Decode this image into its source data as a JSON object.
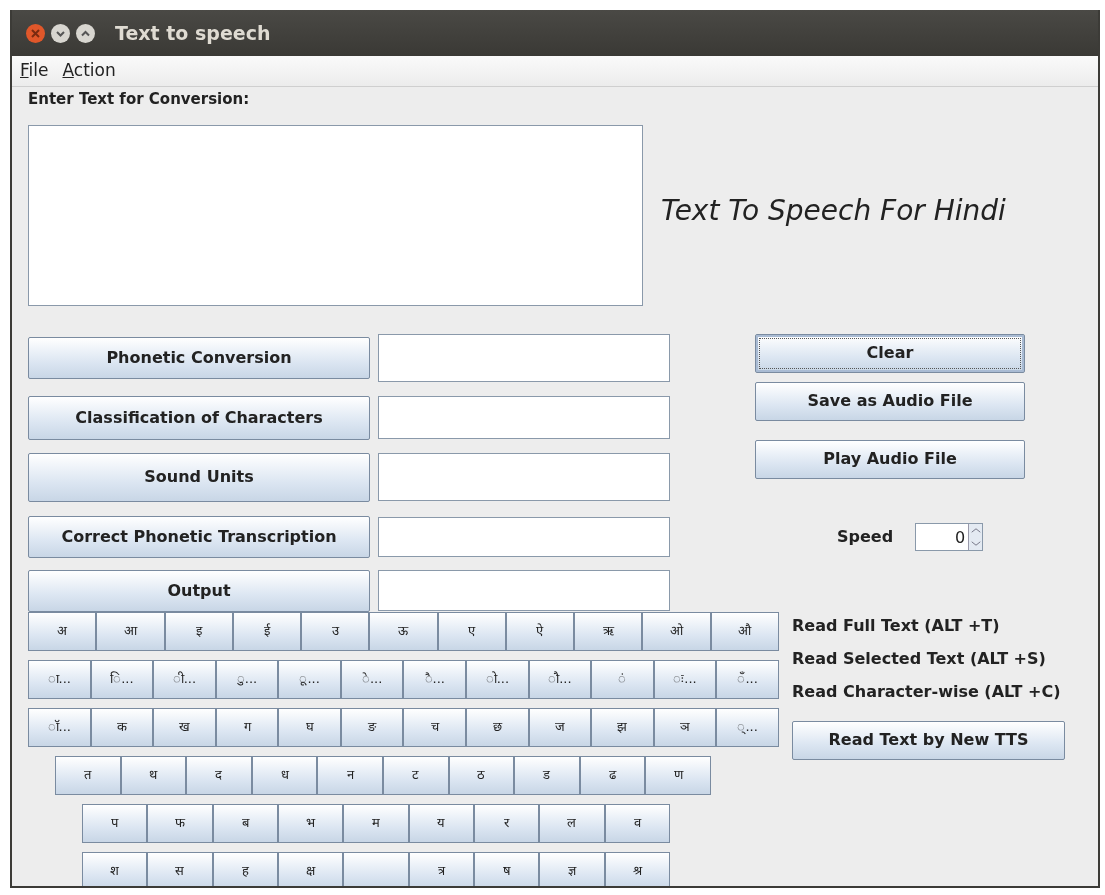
{
  "window": {
    "title": "Text to speech"
  },
  "menu": [
    {
      "label": "File"
    },
    {
      "label": "Action"
    }
  ],
  "input": {
    "label": "Enter Text for Conversion:"
  },
  "heading": "Text To Speech For Hindi",
  "conversion_rows": [
    {
      "button": "Phonetic Conversion",
      "value": ""
    },
    {
      "button": "Classification of Characters",
      "value": ""
    },
    {
      "button": "Sound Units",
      "value": ""
    },
    {
      "button": "Correct Phonetic Transcription",
      "value": ""
    },
    {
      "button": "Output",
      "value": ""
    }
  ],
  "actions": [
    {
      "label": "Clear",
      "focused": true
    },
    {
      "label": "Save as Audio File",
      "focused": false
    },
    {
      "label": "Play Audio File",
      "focused": false
    }
  ],
  "speed": {
    "label": "Speed",
    "value": "0"
  },
  "keyboard_rows": [
    [
      "अ",
      "आ",
      "इ",
      "ई",
      "उ",
      "ऊ",
      "ए",
      "ऐ",
      "ऋ",
      "ओ",
      "औ"
    ],
    [
      "◌ा...",
      "◌ि...",
      "◌ी...",
      "◌ु...",
      "◌ू...",
      "◌े...",
      "◌ै...",
      "◌ो...",
      "◌ौ...",
      "◌ं",
      "◌ः...",
      "◌ँ..."
    ],
    [
      "◌ॉ...",
      "क",
      "ख",
      "ग",
      "घ",
      "ङ",
      "च",
      "छ",
      "ज",
      "झ",
      "ञ",
      "◌्..."
    ],
    [
      "त",
      "थ",
      "द",
      "ध",
      "न",
      "ट",
      "ठ",
      "ड",
      "ढ",
      "ण"
    ],
    [
      "प",
      "फ",
      "ब",
      "भ",
      "म",
      "य",
      "र",
      "ल",
      "व"
    ],
    [
      "श",
      "स",
      "ह",
      "क्ष",
      "",
      "त्र",
      "ष",
      "ज्ञ",
      "श्र"
    ]
  ],
  "shortcuts": [
    "Read Full Text (ALT +T)",
    "Read Selected Text (ALT +S)",
    "Read Character-wise (ALT +C)"
  ],
  "new_tts_button": "Read Text by New TTS"
}
